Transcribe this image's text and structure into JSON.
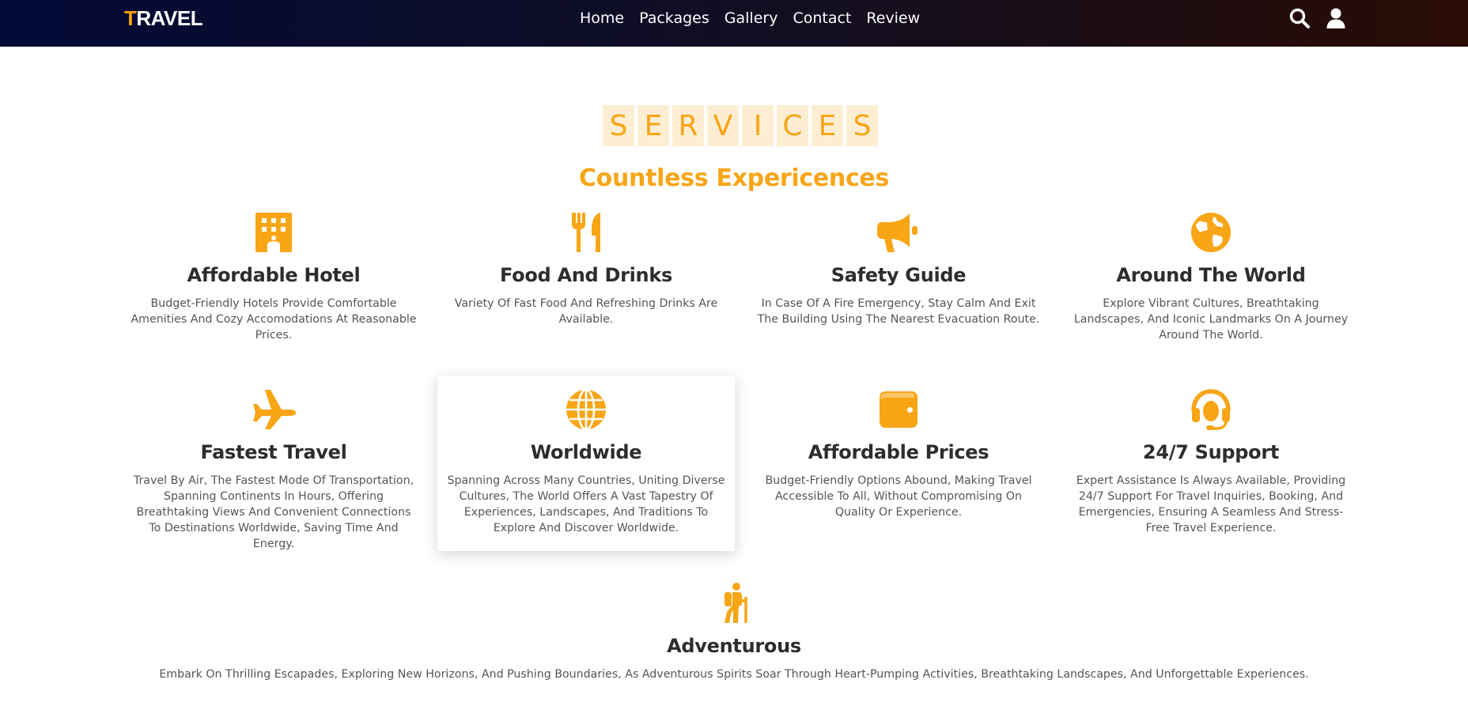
{
  "header": {
    "logo_first": "T",
    "logo_rest": "RAVEL",
    "nav": [
      "Home",
      "Packages",
      "Gallery",
      "Contact",
      "Review"
    ]
  },
  "section": {
    "heading_letters": [
      "S",
      "E",
      "R",
      "V",
      "I",
      "C",
      "E",
      "S"
    ],
    "subtitle": "Countless Expericences"
  },
  "colors": {
    "accent": "#f8a516",
    "tile_bg": "#fdeed3",
    "header_start": "#020a36",
    "header_end": "#2a0c04"
  },
  "services": [
    {
      "icon": "hotel-icon",
      "title": "Affordable Hotel",
      "text": "Budget-Friendly Hotels Provide Comfortable Amenities And Cozy Accomodations At Reasonable Prices."
    },
    {
      "icon": "utensils-icon",
      "title": "Food And Drinks",
      "text": "Variety Of Fast Food And Refreshing Drinks Are Available."
    },
    {
      "icon": "bullhorn-icon",
      "title": "Safety Guide",
      "text": "In Case Of A Fire Emergency, Stay Calm And Exit The Building Using The Nearest Evacuation Route."
    },
    {
      "icon": "earth-icon",
      "title": "Around The World",
      "text": "Explore Vibrant Cultures, Breathtaking Landscapes, And Iconic Landmarks On A Journey Around The World."
    },
    {
      "icon": "plane-icon",
      "title": "Fastest Travel",
      "text": "Travel By Air, The Fastest Mode Of Transportation, Spanning Continents In Hours, Offering Breathtaking Views And Convenient Connections To Destinations Worldwide, Saving Time And Energy."
    },
    {
      "icon": "globe-icon",
      "title": "Worldwide",
      "text": "Spanning Across Many Countries, Uniting Diverse Cultures, The World Offers A Vast Tapestry Of Experiences, Landscapes, And Traditions To Explore And Discover Worldwide."
    },
    {
      "icon": "wallet-icon",
      "title": "Affordable Prices",
      "text": "Budget-Friendly Options Abound, Making Travel Accessible To All, Without Compromising On Quality Or Experience."
    },
    {
      "icon": "headset-icon",
      "title": "24/7 Support",
      "text": "Expert Assistance Is Always Available, Providing 24/7 Support For Travel Inquiries, Booking, And Emergencies, Ensuring A Seamless And Stress-Free Travel Experience."
    },
    {
      "icon": "hiker-icon",
      "title": "Adventurous",
      "text": "Embark On Thrilling Escapades, Exploring New Horizons, And Pushing Boundaries, As Adventurous Spirits Soar Through Heart-Pumping Activities, Breathtaking Landscapes, And Unforgettable Experiences."
    }
  ]
}
